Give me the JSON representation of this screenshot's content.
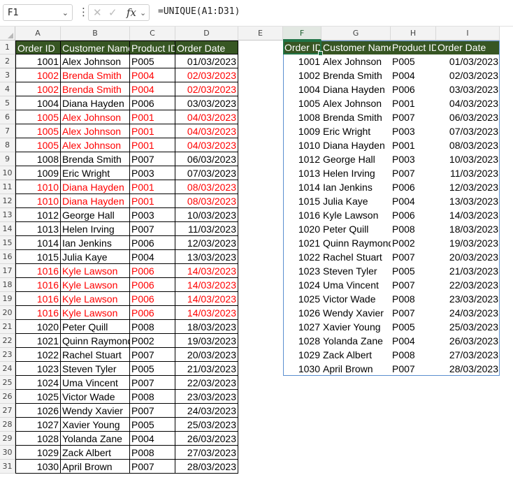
{
  "formula_bar": {
    "name_box": "F1",
    "fx_label": "fx",
    "formula": "=UNIQUE(A1:D31)"
  },
  "columns": [
    "A",
    "B",
    "C",
    "D",
    "E",
    "F",
    "G",
    "H",
    "I"
  ],
  "row_numbers": [
    "1",
    "2",
    "3",
    "4",
    "5",
    "6",
    "7",
    "8",
    "9",
    "10",
    "11",
    "12",
    "13",
    "14",
    "15",
    "16",
    "17",
    "18",
    "19",
    "20",
    "21",
    "22",
    "23",
    "24",
    "25",
    "26",
    "27",
    "28",
    "29",
    "30",
    "31"
  ],
  "colors": {
    "header_bg": "#375623",
    "header_text": "#ffffff",
    "duplicate_text": "#ff0000",
    "selection": "#217346",
    "spill_border": "#5b8fd0"
  },
  "source_table": {
    "headers": [
      "Order ID",
      "Customer Name",
      "Product ID",
      "Order Date"
    ],
    "rows": [
      {
        "cells": [
          "1001",
          "Alex Johnson",
          "P005",
          "01/03/2023"
        ],
        "dup": false
      },
      {
        "cells": [
          "1002",
          "Brenda Smith",
          "P004",
          "02/03/2023"
        ],
        "dup": true
      },
      {
        "cells": [
          "1002",
          "Brenda Smith",
          "P004",
          "02/03/2023"
        ],
        "dup": true
      },
      {
        "cells": [
          "1004",
          "Diana Hayden",
          "P006",
          "03/03/2023"
        ],
        "dup": false
      },
      {
        "cells": [
          "1005",
          "Alex Johnson",
          "P001",
          "04/03/2023"
        ],
        "dup": true
      },
      {
        "cells": [
          "1005",
          "Alex Johnson",
          "P001",
          "04/03/2023"
        ],
        "dup": true
      },
      {
        "cells": [
          "1005",
          "Alex Johnson",
          "P001",
          "04/03/2023"
        ],
        "dup": true
      },
      {
        "cells": [
          "1008",
          "Brenda Smith",
          "P007",
          "06/03/2023"
        ],
        "dup": false
      },
      {
        "cells": [
          "1009",
          "Eric Wright",
          "P003",
          "07/03/2023"
        ],
        "dup": false
      },
      {
        "cells": [
          "1010",
          "Diana Hayden",
          "P001",
          "08/03/2023"
        ],
        "dup": true
      },
      {
        "cells": [
          "1010",
          "Diana Hayden",
          "P001",
          "08/03/2023"
        ],
        "dup": true
      },
      {
        "cells": [
          "1012",
          "George Hall",
          "P003",
          "10/03/2023"
        ],
        "dup": false
      },
      {
        "cells": [
          "1013",
          "Helen Irving",
          "P007",
          "11/03/2023"
        ],
        "dup": false
      },
      {
        "cells": [
          "1014",
          "Ian Jenkins",
          "P006",
          "12/03/2023"
        ],
        "dup": false
      },
      {
        "cells": [
          "1015",
          "Julia Kaye",
          "P004",
          "13/03/2023"
        ],
        "dup": false
      },
      {
        "cells": [
          "1016",
          "Kyle Lawson",
          "P006",
          "14/03/2023"
        ],
        "dup": true
      },
      {
        "cells": [
          "1016",
          "Kyle Lawson",
          "P006",
          "14/03/2023"
        ],
        "dup": true
      },
      {
        "cells": [
          "1016",
          "Kyle Lawson",
          "P006",
          "14/03/2023"
        ],
        "dup": true
      },
      {
        "cells": [
          "1016",
          "Kyle Lawson",
          "P006",
          "14/03/2023"
        ],
        "dup": true
      },
      {
        "cells": [
          "1020",
          "Peter Quill",
          "P008",
          "18/03/2023"
        ],
        "dup": false
      },
      {
        "cells": [
          "1021",
          "Quinn Raymond",
          "P002",
          "19/03/2023"
        ],
        "dup": false
      },
      {
        "cells": [
          "1022",
          "Rachel Stuart",
          "P007",
          "20/03/2023"
        ],
        "dup": false
      },
      {
        "cells": [
          "1023",
          "Steven Tyler",
          "P005",
          "21/03/2023"
        ],
        "dup": false
      },
      {
        "cells": [
          "1024",
          "Uma Vincent",
          "P007",
          "22/03/2023"
        ],
        "dup": false
      },
      {
        "cells": [
          "1025",
          "Victor Wade",
          "P008",
          "23/03/2023"
        ],
        "dup": false
      },
      {
        "cells": [
          "1026",
          "Wendy Xavier",
          "P007",
          "24/03/2023"
        ],
        "dup": false
      },
      {
        "cells": [
          "1027",
          "Xavier Young",
          "P005",
          "25/03/2023"
        ],
        "dup": false
      },
      {
        "cells": [
          "1028",
          "Yolanda Zane",
          "P004",
          "26/03/2023"
        ],
        "dup": false
      },
      {
        "cells": [
          "1029",
          "Zack Albert",
          "P008",
          "27/03/2023"
        ],
        "dup": false
      },
      {
        "cells": [
          "1030",
          "April Brown",
          "P007",
          "28/03/2023"
        ],
        "dup": false
      }
    ]
  },
  "unique_table": {
    "headers": [
      "Order ID",
      "Customer Name",
      "Product ID",
      "Order Date"
    ],
    "rows": [
      [
        "1001",
        "Alex Johnson",
        "P005",
        "01/03/2023"
      ],
      [
        "1002",
        "Brenda Smith",
        "P004",
        "02/03/2023"
      ],
      [
        "1004",
        "Diana Hayden",
        "P006",
        "03/03/2023"
      ],
      [
        "1005",
        "Alex Johnson",
        "P001",
        "04/03/2023"
      ],
      [
        "1008",
        "Brenda Smith",
        "P007",
        "06/03/2023"
      ],
      [
        "1009",
        "Eric Wright",
        "P003",
        "07/03/2023"
      ],
      [
        "1010",
        "Diana Hayden",
        "P001",
        "08/03/2023"
      ],
      [
        "1012",
        "George Hall",
        "P003",
        "10/03/2023"
      ],
      [
        "1013",
        "Helen Irving",
        "P007",
        "11/03/2023"
      ],
      [
        "1014",
        "Ian Jenkins",
        "P006",
        "12/03/2023"
      ],
      [
        "1015",
        "Julia Kaye",
        "P004",
        "13/03/2023"
      ],
      [
        "1016",
        "Kyle Lawson",
        "P006",
        "14/03/2023"
      ],
      [
        "1020",
        "Peter Quill",
        "P008",
        "18/03/2023"
      ],
      [
        "1021",
        "Quinn Raymond",
        "P002",
        "19/03/2023"
      ],
      [
        "1022",
        "Rachel Stuart",
        "P007",
        "20/03/2023"
      ],
      [
        "1023",
        "Steven Tyler",
        "P005",
        "21/03/2023"
      ],
      [
        "1024",
        "Uma Vincent",
        "P007",
        "22/03/2023"
      ],
      [
        "1025",
        "Victor Wade",
        "P008",
        "23/03/2023"
      ],
      [
        "1026",
        "Wendy Xavier",
        "P007",
        "24/03/2023"
      ],
      [
        "1027",
        "Xavier Young",
        "P005",
        "25/03/2023"
      ],
      [
        "1028",
        "Yolanda Zane",
        "P004",
        "26/03/2023"
      ],
      [
        "1029",
        "Zack Albert",
        "P008",
        "27/03/2023"
      ],
      [
        "1030",
        "April Brown",
        "P007",
        "28/03/2023"
      ]
    ]
  }
}
